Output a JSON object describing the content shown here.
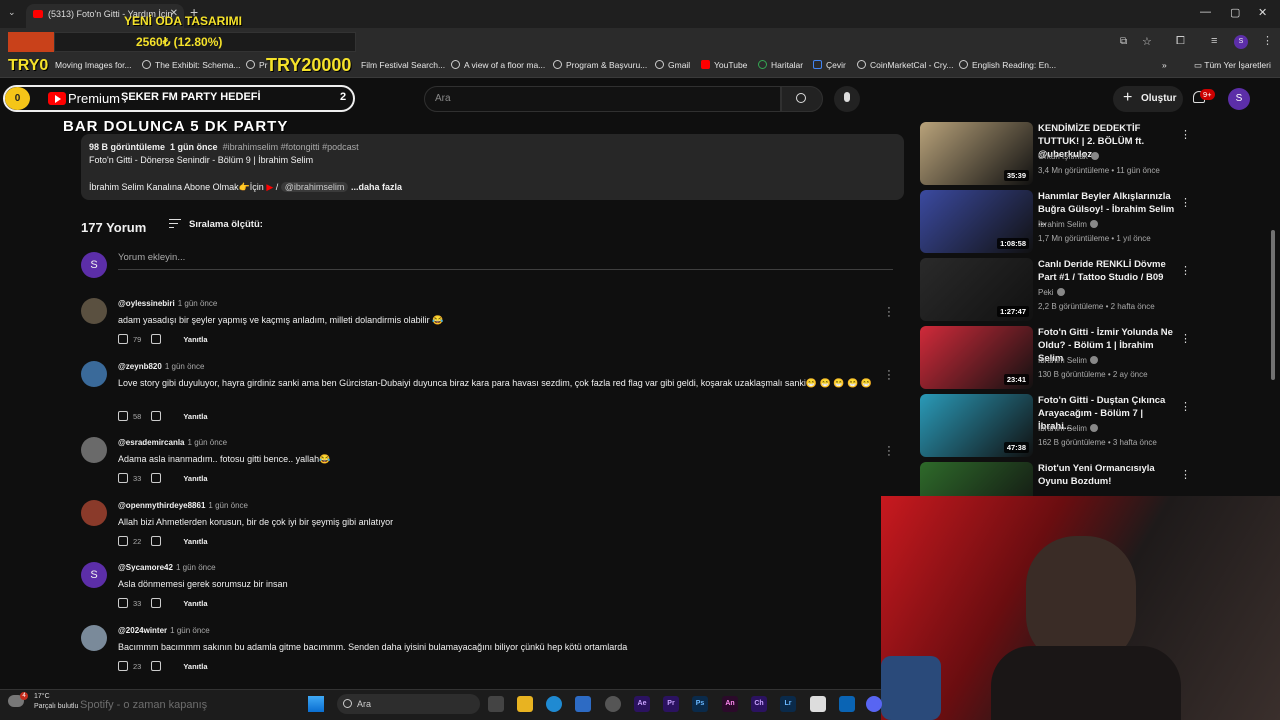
{
  "browser": {
    "tab_title": "(5313) Foto'n Gitti - Yardım İçin",
    "bookmarks": [
      "Moving Images for...",
      "The Exhibit: Schema...",
      "Pr",
      "Film Festival Search...",
      "A view of a floor ma...",
      "Program & Başvuru...",
      "Gmail",
      "YouTube",
      "Haritalar",
      "Çevir",
      "CoinMarketCal - Cry...",
      "English Reading: En..."
    ],
    "bookmarks_folder": "Tüm Yer İşaretleri"
  },
  "overlay": {
    "title": "YENİ ODA TASARIMI",
    "amount": "2560₺ (12.80%)",
    "try_left": "TRY0",
    "try_right": "TRY20000",
    "pill_coin": "0",
    "pill_label": "ŞEKER FM PARTY HEDEFİ",
    "pill_count": "2",
    "party_text": "BAR DOLUNCA 5 DK PARTY",
    "ticker": "Spotify - o zaman kapanış"
  },
  "header": {
    "logo_label": "Premium",
    "search_placeholder": "Ara",
    "create_label": "Oluştur",
    "notif_badge": "9+",
    "avatar_letter": "S"
  },
  "description": {
    "views": "98 B görüntüleme",
    "age": "1 gün önce",
    "tags": "#ibrahimselim #fotongitti #podcast",
    "line1": "Foto'n Gitti - Dönerse Senindir - Bölüm 9 | İbrahim Selim",
    "line2_prefix": "İbrahim Selim Kanalına Abone Olmak👉İçin",
    "line2_sep": "/",
    "channel_link": "@ibrahimselim",
    "more": "...daha fazla"
  },
  "comments_section": {
    "count": "177 Yorum",
    "sort_label": "Sıralama ölçütü:",
    "input_placeholder": "Yorum ekleyin...",
    "my_avatar": "S",
    "reply_label": "Yanıtla",
    "items": [
      {
        "handle": "@oylessinebiri",
        "time": "1 gün önce",
        "text": "adam yasadışı bir şeyler yapmış ve kaçmış anladım, milleti dolandirmis olabilir 😂",
        "likes": "79",
        "avatar_color": "#5a5040"
      },
      {
        "handle": "@zeynb820",
        "time": "1 gün önce",
        "text": "Love story gibi duyuluyor, hayra girdiniz sanki ama ben Gürcistan-Dubaiyi duyunca biraz kara para havası sezdim, çok fazla red flag var gibi geldi, koşarak uzaklaşmalı sanki😁 😁 😁 😁 😁",
        "likes": "58",
        "avatar_color": "#3a6a9a"
      },
      {
        "handle": "@esrademircanla",
        "time": "1 gün önce",
        "text": "Adama asla inanmadım.. fotosu gitti bence.. yallah😂",
        "likes": "33",
        "avatar_color": "#6a6a6a"
      },
      {
        "handle": "@openmythirdeye8861",
        "time": "1 gün önce",
        "text": "Allah bizi Ahmetlerden korusun, bir de çok iyi bir şeymiş gibi anlatıyor",
        "likes": "22",
        "avatar_color": "#8a3a2a"
      },
      {
        "handle": "@Sycamore42",
        "time": "1 gün önce",
        "text": "Asla dönmemesi gerek sorumsuz bir insan",
        "likes": "33",
        "avatar_color": "#5c2ea8",
        "avatar_letter": "S"
      },
      {
        "handle": "@2024winter",
        "time": "1 gün önce",
        "text": "Bacımmm bacımmm sakının bu adamla gitme bacımmm. Senden daha iyisini bulamayacağını biliyor çünkü hep kötü ortamlarda",
        "likes": "23",
        "avatar_color": "#7a8a9a"
      }
    ]
  },
  "related": [
    {
      "title": "KENDİMİZE DEDEKTİF TUTTUK! | 2. BÖLÜM ft. @uberkuloz",
      "channel": "Orkun Işıtmak",
      "meta": "3,4 Mn görüntüleme • 11 gün önce",
      "duration": "35:39",
      "thumb": "#b8a27a"
    },
    {
      "title": "Hanımlar Beyler Alkışlarınızla Buğra Gülsoy! - İbrahim Selim ...",
      "channel": "İbrahim Selim",
      "meta": "1,7 Mn görüntüleme • 1 yıl önce",
      "duration": "1:08:58",
      "thumb": "#3b4aa0"
    },
    {
      "title": "Canlı Deride RENKLİ Dövme Part #1 / Tattoo Studio / B09",
      "channel": "Peki",
      "meta": "2,2 B görüntüleme • 2 hafta önce",
      "duration": "1:27:47",
      "thumb": "#2a2a2a"
    },
    {
      "title": "Foto'n Gitti - İzmir Yolunda Ne Oldu? - Bölüm 1 | İbrahim Selim",
      "channel": "İbrahim Selim",
      "meta": "130 B görüntüleme • 2 ay önce",
      "duration": "23:41",
      "thumb": "#d02a3a"
    },
    {
      "title": "Foto'n Gitti - Duştan Çıkınca Arayacağım - Bölüm 7 | İbrahi...",
      "channel": "İbrahim Selim",
      "meta": "162 B görüntüleme • 3 hafta önce",
      "duration": "47:38",
      "thumb": "#2a9ab8"
    },
    {
      "title": "Riot'un Yeni Ormancısıyla Oyunu Bozdum!",
      "channel": "",
      "meta": "",
      "duration": "",
      "thumb": "#2e6a2a"
    }
  ],
  "taskbar": {
    "temperature": "17°C",
    "weather_text": "Parçalı bulutlu",
    "weather_badge": "4",
    "search_label": "Ara"
  },
  "colors": {
    "accent": "#ff0000",
    "overlay_text": "#f5e22a",
    "background": "#0f0f0f"
  }
}
